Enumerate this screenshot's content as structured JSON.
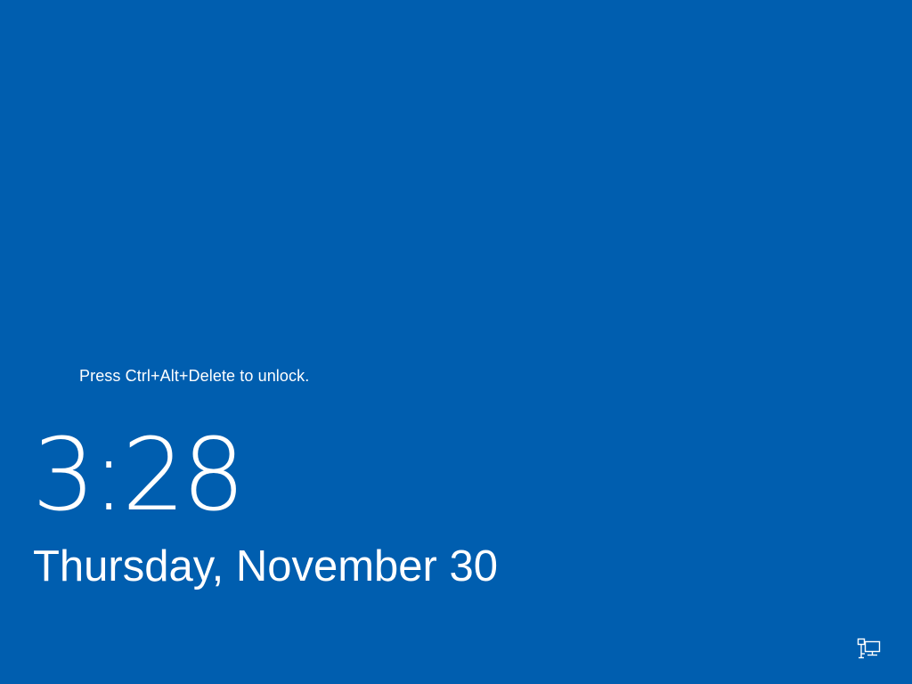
{
  "lock_screen": {
    "unlock_hint": "Press Ctrl+Alt+Delete to unlock.",
    "time": "3:28",
    "date": "Thursday, November 30",
    "background_color": "#005EAF",
    "text_color": "#FFFFFF"
  },
  "system_tray": {
    "network_icon": "network-icon"
  }
}
